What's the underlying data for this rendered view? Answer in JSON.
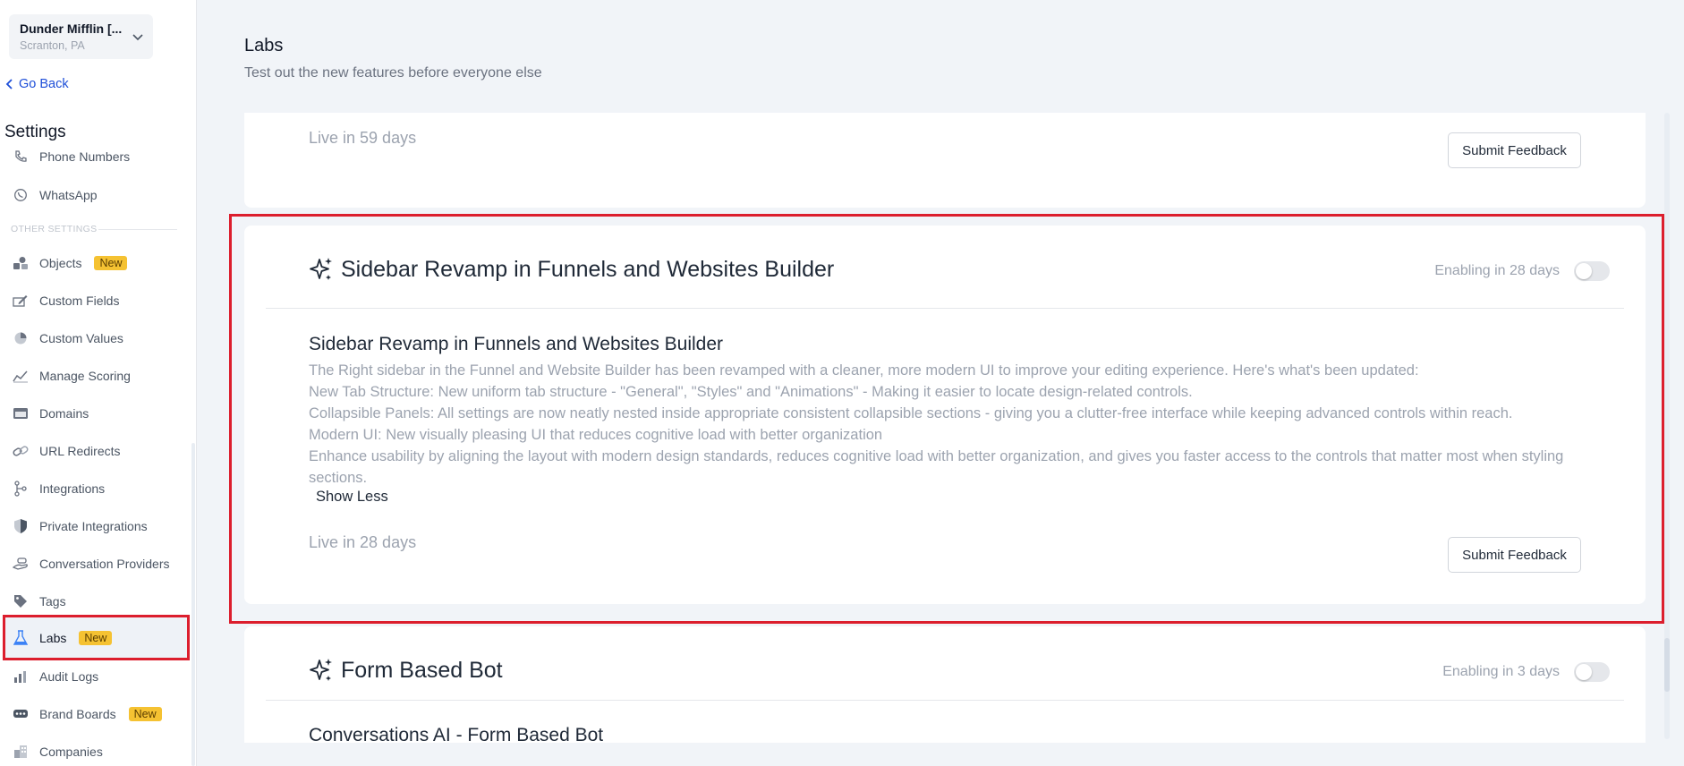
{
  "location": {
    "name": "Dunder Mifflin [...",
    "city": "Scranton, PA"
  },
  "nav": {
    "go_back": "Go Back",
    "settings_title": "Settings",
    "cut_item": "Phone Numbers",
    "whatsapp": "WhatsApp",
    "section_label": "OTHER SETTINGS",
    "objects": "Objects",
    "custom_fields": "Custom Fields",
    "custom_values": "Custom Values",
    "manage_scoring": "Manage Scoring",
    "domains": "Domains",
    "url_redirects": "URL Redirects",
    "integrations": "Integrations",
    "private_integrations": "Private Integrations",
    "conversation_providers": "Conversation Providers",
    "tags": "Tags",
    "labs": "Labs",
    "audit_logs": "Audit Logs",
    "brand_boards": "Brand Boards",
    "companies": "Companies",
    "new_badge": "New"
  },
  "page": {
    "title": "Labs",
    "subtitle": "Test out the new features before everyone else"
  },
  "cards": {
    "top": {
      "live": "Live in 59 days",
      "feedback": "Submit Feedback"
    },
    "sidebar_revamp": {
      "title": "Sidebar Revamp in Funnels and Websites Builder",
      "enabling": "Enabling in 28 days",
      "subtitle": "Sidebar Revamp in Funnels and Websites Builder",
      "desc_1": "The Right sidebar in the Funnel and Website Builder has been revamped with a cleaner, more modern UI to improve your editing experience. Here's what's been updated:",
      "desc_2": "New Tab Structure: New uniform tab structure - \"General\", \"Styles\" and \"Animations\" - Making it easier to locate design-related controls.",
      "desc_3": "Collapsible Panels: All settings are now neatly nested inside appropriate consistent collapsible sections - giving you a clutter-free interface while keeping advanced controls within reach.",
      "desc_4": "Modern UI: New visually pleasing UI that reduces cognitive load with better organization",
      "desc_5": "Enhance usability by aligning the layout with modern design standards, reduces cognitive load with better organization, and gives you faster access to the controls that matter most when styling sections.",
      "show_less": "Show Less",
      "live": "Live in 28 days",
      "feedback": "Submit Feedback"
    },
    "form_bot": {
      "title": "Form Based Bot",
      "enabling": "Enabling in 3 days",
      "subtitle": "Conversations AI - Form Based Bot"
    }
  }
}
